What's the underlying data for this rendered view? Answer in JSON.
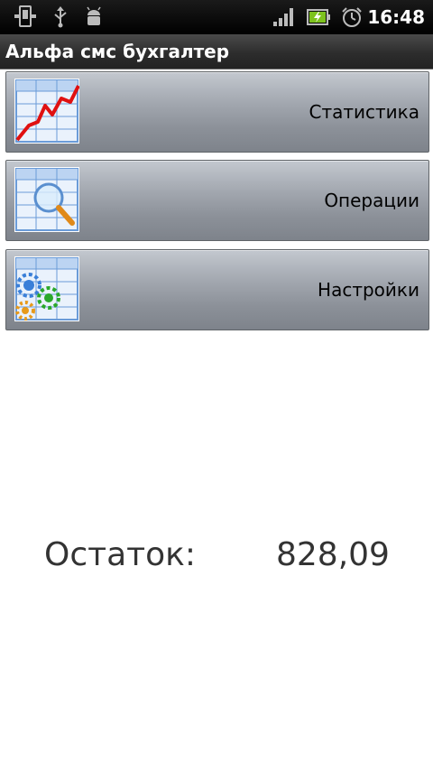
{
  "status_bar": {
    "time": "16:48",
    "icons": [
      "device-icon",
      "usb-icon",
      "android-debug-icon",
      "signal-icon",
      "battery-charging-icon",
      "alarm-icon"
    ]
  },
  "app": {
    "title": "Альфа смс бухгалтер"
  },
  "menu": [
    {
      "label": "Статистика",
      "icon": "statistics-chart-icon"
    },
    {
      "label": "Операции",
      "icon": "operations-search-icon"
    },
    {
      "label": "Настройки",
      "icon": "settings-gears-icon"
    }
  ],
  "balance": {
    "label": "Остаток:",
    "value": "828,09"
  }
}
